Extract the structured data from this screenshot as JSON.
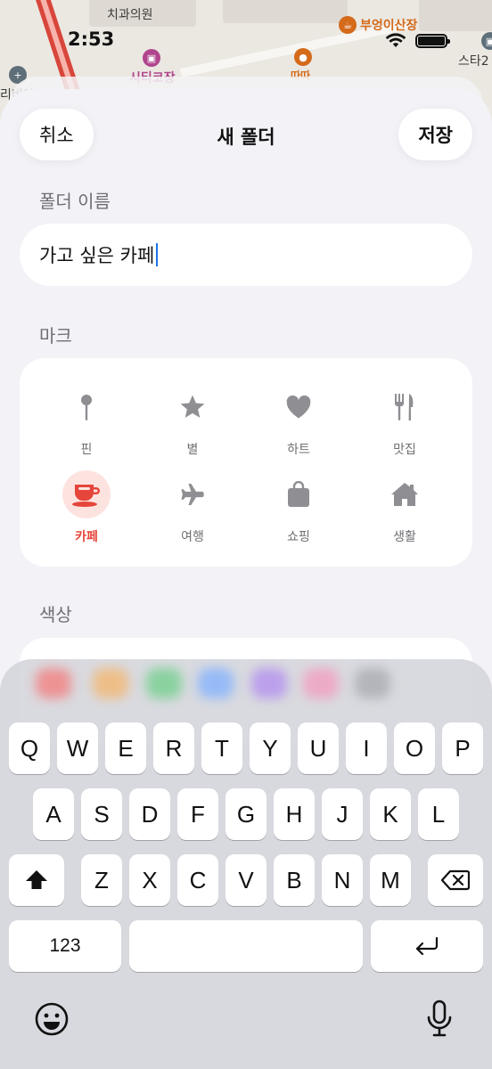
{
  "status_bar": {
    "time": "2:53"
  },
  "map": {
    "labels": [
      "치과의원",
      "부엉이산장",
      "따따",
      "스타2",
      "리비아",
      "시티코장"
    ]
  },
  "sheet": {
    "cancel_label": "취소",
    "title": "새 폴더",
    "save_label": "저장",
    "name_section": "폴더 이름",
    "name_value": "가고 싶은 카페",
    "mark_section": "마크",
    "color_section": "색상",
    "marks": [
      {
        "label": "핀",
        "icon": "pin-icon"
      },
      {
        "label": "별",
        "icon": "star-icon"
      },
      {
        "label": "하트",
        "icon": "heart-icon"
      },
      {
        "label": "맛집",
        "icon": "fork-knife-icon"
      },
      {
        "label": "카페",
        "icon": "coffee-cup-icon",
        "selected": true
      },
      {
        "label": "여행",
        "icon": "airplane-icon"
      },
      {
        "label": "쇼핑",
        "icon": "shopping-bag-icon"
      },
      {
        "label": "생활",
        "icon": "house-icon"
      }
    ],
    "accent_color": "#e5453a",
    "color_swatches": [
      "#f47b7b",
      "#f5b56b",
      "#6fcf8a",
      "#7fb0ff",
      "#b18cf0",
      "#f49ac1",
      "#a7a9b0"
    ]
  },
  "keyboard": {
    "row1": [
      "Q",
      "W",
      "E",
      "R",
      "T",
      "Y",
      "U",
      "I",
      "O",
      "P"
    ],
    "row2": [
      "A",
      "S",
      "D",
      "F",
      "G",
      "H",
      "J",
      "K",
      "L"
    ],
    "row3": [
      "Z",
      "X",
      "C",
      "V",
      "B",
      "N",
      "M"
    ],
    "numbers_label": "123"
  }
}
